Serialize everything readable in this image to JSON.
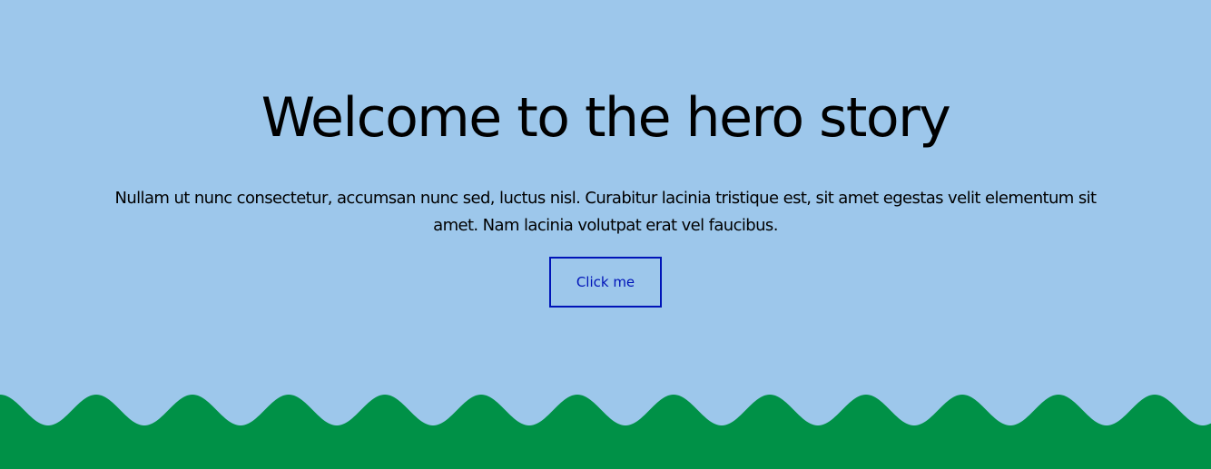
{
  "colors": {
    "background": "#9dc7eb",
    "grass": "#009147",
    "button_accent": "#0014b8",
    "text": "#000000"
  },
  "hero": {
    "title": "Welcome to the hero story",
    "body": "Nullam ut nunc consectetur, accumsan nunc sed, luctus nisl. Curabitur lacinia tristique est, sit amet egestas velit elementum sit amet. Nam lacinia volutpat erat vel faucibus.",
    "button_label": "Click me"
  }
}
